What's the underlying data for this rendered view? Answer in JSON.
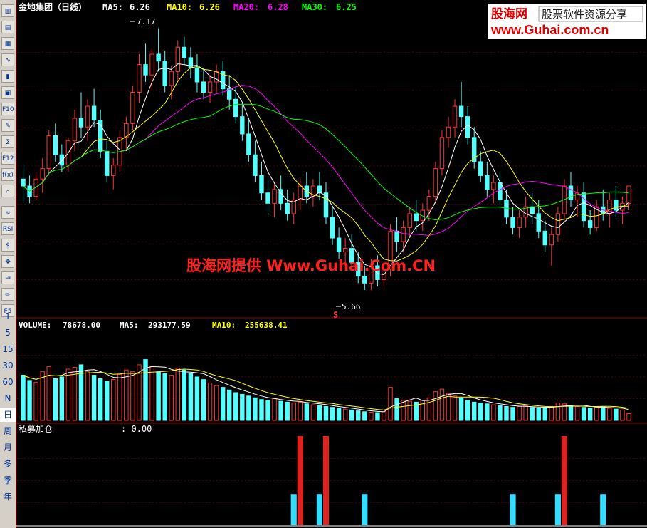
{
  "toolbar": {
    "icons": [
      "candlestick-icon",
      "table-icon",
      "grid-icon",
      "line-chart-icon",
      "bars-icon",
      "layers-icon",
      "f10-icon",
      "notes-icon",
      "formula-icon",
      "f12-icon",
      "function-icon",
      "search-icon",
      "wave-icon",
      "rsi-icon",
      "dollar-icon",
      "move-icon",
      "export-icon",
      "pencil-icon",
      "f5-icon"
    ],
    "icon_labels": {
      "f10": "F10",
      "f12": "F12",
      "rsi": "RSI",
      "dollar": "$",
      "f5": "F5",
      "fx": "f(x)"
    },
    "periods": [
      "1",
      "5",
      "15",
      "30",
      "60",
      "N",
      "日",
      "周",
      "月",
      "多",
      "季",
      "年"
    ],
    "selected_period": "日"
  },
  "colors": {
    "up": "#ff3232",
    "down": "#54ffff",
    "ma5": "#ffffff",
    "ma10": "#ffff00",
    "ma20": "#ff00ff",
    "ma30": "#00ff00",
    "grid": "#a00000",
    "label": "#ffffff",
    "indicator_up": "#dd2222",
    "indicator_down": "#33ddff",
    "watermark": "#ff2020",
    "logo_red": "#e00000",
    "logo_blue": "#1144cc"
  },
  "price_header": {
    "title": "金地集团（日线）",
    "ma5_label": "MA5:",
    "ma5_value": "6.26",
    "ma10_label": "MA10:",
    "ma10_value": "6.26",
    "ma20_label": "MA20:",
    "ma20_value": "6.28",
    "ma30_label": "MA30:",
    "ma30_value": "6.25"
  },
  "volume_header": {
    "volume_label": "VOLUME:",
    "volume_value": "78678.00",
    "ma5_label": "MA5:",
    "ma5_value": "293177.59",
    "ma10_label": "MA10:",
    "ma10_value": "255638.41"
  },
  "indicator_header": {
    "name": "私募加仓",
    "value": ": 0.00"
  },
  "annotations": {
    "high_label": "7.17",
    "low_label": "5.66",
    "s_marker": "S"
  },
  "watermark": {
    "text": "股海网提供 Www.Guhai.Com.CN"
  },
  "logo": {
    "brand": "股海网",
    "slogan": "股票软件资源分享",
    "url": "www.Guhai.com.cn"
  },
  "chart_data": [
    {
      "type": "candlestick",
      "name": "金地集团 日线",
      "y_range": [
        5.5,
        7.25
      ],
      "x_count": 95,
      "candles": [
        [
          6.3,
          6.38,
          6.16,
          6.26
        ],
        [
          6.26,
          6.32,
          6.16,
          6.2
        ],
        [
          6.2,
          6.34,
          6.18,
          6.3
        ],
        [
          6.3,
          6.42,
          6.22,
          6.36
        ],
        [
          6.36,
          6.58,
          6.32,
          6.55
        ],
        [
          6.55,
          6.62,
          6.4,
          6.44
        ],
        [
          6.44,
          6.5,
          6.34,
          6.38
        ],
        [
          6.38,
          6.54,
          6.34,
          6.52
        ],
        [
          6.52,
          6.7,
          6.46,
          6.65
        ],
        [
          6.65,
          6.8,
          6.54,
          6.6
        ],
        [
          6.6,
          6.76,
          6.52,
          6.72
        ],
        [
          6.72,
          6.82,
          6.6,
          6.64
        ],
        [
          6.64,
          6.7,
          6.42,
          6.46
        ],
        [
          6.46,
          6.52,
          6.28,
          6.32
        ],
        [
          6.32,
          6.42,
          6.24,
          6.38
        ],
        [
          6.38,
          6.58,
          6.34,
          6.54
        ],
        [
          6.54,
          6.66,
          6.46,
          6.62
        ],
        [
          6.62,
          6.84,
          6.58,
          6.8
        ],
        [
          6.8,
          7.02,
          6.74,
          6.96
        ],
        [
          6.96,
          7.08,
          6.86,
          6.9
        ],
        [
          6.9,
          7.05,
          6.82,
          7.02
        ],
        [
          7.02,
          7.17,
          6.92,
          6.98
        ],
        [
          6.98,
          7.04,
          6.8,
          6.84
        ],
        [
          6.84,
          6.95,
          6.76,
          6.92
        ],
        [
          6.92,
          7.1,
          6.86,
          7.06
        ],
        [
          7.06,
          7.12,
          6.96,
          7.0
        ],
        [
          7.0,
          7.06,
          6.88,
          6.94
        ],
        [
          6.94,
          7.02,
          6.8,
          6.86
        ],
        [
          6.86,
          6.94,
          6.76,
          6.8
        ],
        [
          6.8,
          6.9,
          6.74,
          6.86
        ],
        [
          6.86,
          6.96,
          6.8,
          6.92
        ],
        [
          6.92,
          6.98,
          6.78,
          6.82
        ],
        [
          6.82,
          6.9,
          6.7,
          6.76
        ],
        [
          6.76,
          6.84,
          6.62,
          6.66
        ],
        [
          6.66,
          6.74,
          6.52,
          6.56
        ],
        [
          6.56,
          6.64,
          6.4,
          6.44
        ],
        [
          6.44,
          6.52,
          6.28,
          6.32
        ],
        [
          6.32,
          6.4,
          6.18,
          6.22
        ],
        [
          6.22,
          6.3,
          6.1,
          6.16
        ],
        [
          6.16,
          6.28,
          6.08,
          6.24
        ],
        [
          6.24,
          6.32,
          6.12,
          6.16
        ],
        [
          6.16,
          6.24,
          6.06,
          6.1
        ],
        [
          6.1,
          6.22,
          6.04,
          6.18
        ],
        [
          6.18,
          6.3,
          6.12,
          6.26
        ],
        [
          6.26,
          6.34,
          6.16,
          6.2
        ],
        [
          6.2,
          6.3,
          6.14,
          6.26
        ],
        [
          6.26,
          6.34,
          6.18,
          6.22
        ],
        [
          6.22,
          6.28,
          6.04,
          6.08
        ],
        [
          6.08,
          6.14,
          5.92,
          5.96
        ],
        [
          5.96,
          6.02,
          5.84,
          5.88
        ],
        [
          5.88,
          5.96,
          5.8,
          5.9
        ],
        [
          5.9,
          5.98,
          5.78,
          5.82
        ],
        [
          5.82,
          5.88,
          5.7,
          5.74
        ],
        [
          5.74,
          5.8,
          5.66,
          5.7
        ],
        [
          5.7,
          5.84,
          5.66,
          5.8
        ],
        [
          5.8,
          5.86,
          5.68,
          5.72
        ],
        [
          5.72,
          5.82,
          5.68,
          5.78
        ],
        [
          5.78,
          6.04,
          5.74,
          6.0
        ],
        [
          6.0,
          6.08,
          5.88,
          5.94
        ],
        [
          5.94,
          6.06,
          5.88,
          6.02
        ],
        [
          6.02,
          6.14,
          5.96,
          6.1
        ],
        [
          6.1,
          6.18,
          6.0,
          6.06
        ],
        [
          6.06,
          6.16,
          6.0,
          6.12
        ],
        [
          6.12,
          6.24,
          6.06,
          6.2
        ],
        [
          6.2,
          6.4,
          6.16,
          6.36
        ],
        [
          6.36,
          6.58,
          6.32,
          6.54
        ],
        [
          6.54,
          6.66,
          6.48,
          6.6
        ],
        [
          6.6,
          6.76,
          6.54,
          6.72
        ],
        [
          6.72,
          6.86,
          6.6,
          6.66
        ],
        [
          6.66,
          6.72,
          6.5,
          6.54
        ],
        [
          6.54,
          6.6,
          6.36,
          6.4
        ],
        [
          6.4,
          6.46,
          6.28,
          6.32
        ],
        [
          6.32,
          6.4,
          6.2,
          6.24
        ],
        [
          6.24,
          6.32,
          6.16,
          6.28
        ],
        [
          6.28,
          6.34,
          6.14,
          6.18
        ],
        [
          6.18,
          6.24,
          6.04,
          6.08
        ],
        [
          6.08,
          6.14,
          5.98,
          6.02
        ],
        [
          6.02,
          6.12,
          5.96,
          6.08
        ],
        [
          6.08,
          6.2,
          6.02,
          6.14
        ],
        [
          6.14,
          6.22,
          6.04,
          6.1
        ],
        [
          6.1,
          6.18,
          5.96,
          6.0
        ],
        [
          6.0,
          6.06,
          5.88,
          5.92
        ],
        [
          5.92,
          6.02,
          5.8,
          5.98
        ],
        [
          5.98,
          6.14,
          5.94,
          6.1
        ],
        [
          6.1,
          6.3,
          6.06,
          6.26
        ],
        [
          6.26,
          6.34,
          6.14,
          6.18
        ],
        [
          6.18,
          6.26,
          6.08,
          6.22
        ],
        [
          6.22,
          6.28,
          6.02,
          6.06
        ],
        [
          6.06,
          6.12,
          5.98,
          6.02
        ],
        [
          6.02,
          6.18,
          6.0,
          6.14
        ],
        [
          6.14,
          6.24,
          6.06,
          6.1
        ],
        [
          6.1,
          6.22,
          6.02,
          6.18
        ],
        [
          6.18,
          6.26,
          6.08,
          6.12
        ],
        [
          6.12,
          6.2,
          6.04,
          6.16
        ],
        [
          6.16,
          6.24,
          6.12,
          6.26
        ]
      ],
      "ma_periods": [
        5,
        10,
        20,
        30
      ]
    },
    {
      "type": "bar",
      "name": "VOLUME",
      "y_range": [
        0,
        1000000
      ],
      "values": [
        520000,
        460000,
        440000,
        560000,
        620000,
        480000,
        500000,
        590000,
        610000,
        640000,
        560000,
        520000,
        480000,
        450000,
        470000,
        530000,
        580000,
        560000,
        640000,
        700000,
        620000,
        560000,
        540000,
        520000,
        600000,
        580000,
        540000,
        500000,
        470000,
        430000,
        400000,
        380000,
        350000,
        320000,
        300000,
        280000,
        260000,
        240000,
        230000,
        250000,
        220000,
        210000,
        200000,
        210000,
        190000,
        180000,
        170000,
        160000,
        150000,
        140000,
        130000,
        120000,
        110000,
        100000,
        95000,
        90000,
        100000,
        380000,
        250000,
        230000,
        220000,
        210000,
        230000,
        260000,
        330000,
        360000,
        310000,
        280000,
        260000,
        230000,
        210000,
        200000,
        190000,
        180000,
        170000,
        160000,
        150000,
        160000,
        170000,
        150000,
        140000,
        140000,
        160000,
        200000,
        190000,
        170000,
        160000,
        150000,
        140000,
        150000,
        160000,
        140000,
        130000,
        120000,
        78678
      ],
      "ma_periods": [
        5,
        10
      ]
    },
    {
      "type": "bar",
      "name": "私募加仓",
      "y_range": [
        0,
        1
      ],
      "red_bars_at": [
        43,
        47,
        84
      ],
      "blue_bars_at": [
        42,
        46,
        53,
        76,
        83,
        90
      ],
      "red_value": 1.0,
      "blue_value": 0.35
    }
  ]
}
